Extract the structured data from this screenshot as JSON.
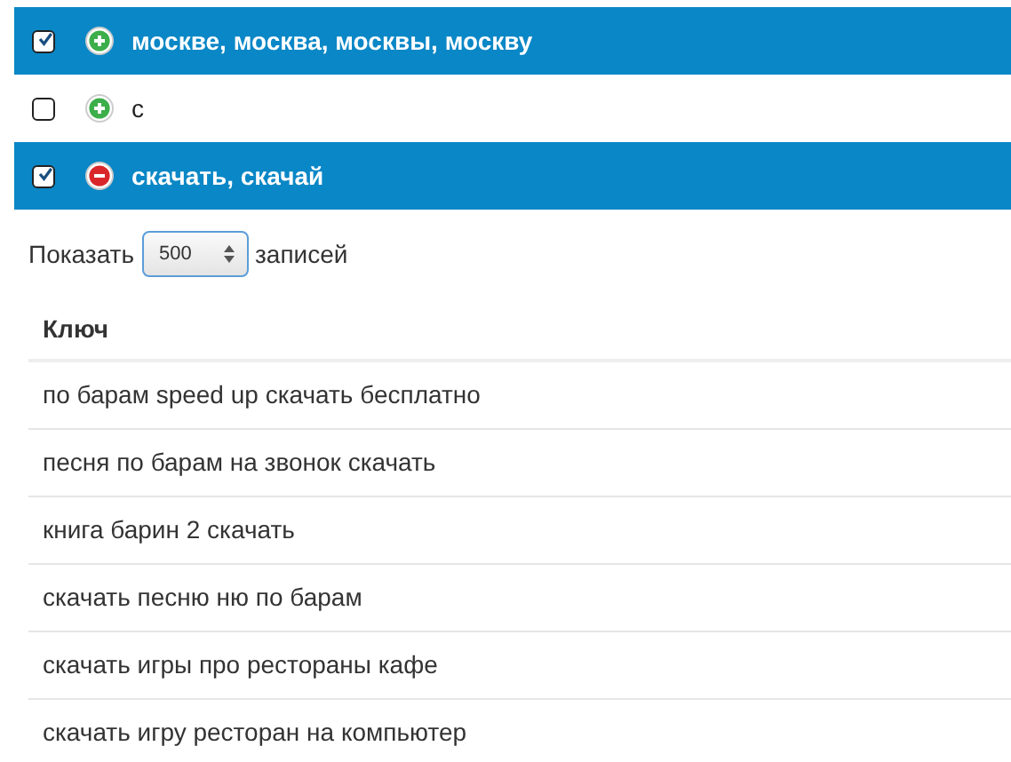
{
  "groups": [
    {
      "checked": true,
      "kind": "add",
      "label": "москве, москва, москвы, москву"
    },
    {
      "checked": false,
      "kind": "add",
      "label": "с"
    },
    {
      "checked": true,
      "kind": "remove",
      "label": "скачать, скачай"
    }
  ],
  "length": {
    "before": "Показать",
    "value": "500",
    "after": "записей"
  },
  "table": {
    "columns": [
      "Ключ"
    ],
    "rows": [
      "по барам speed up скачать бесплатно",
      "песня по барам на звонок скачать",
      "книга барин 2 скачать",
      "скачать песню ню по барам",
      "скачать игры про рестораны кафе",
      "скачать игру ресторан на компьютер"
    ]
  }
}
